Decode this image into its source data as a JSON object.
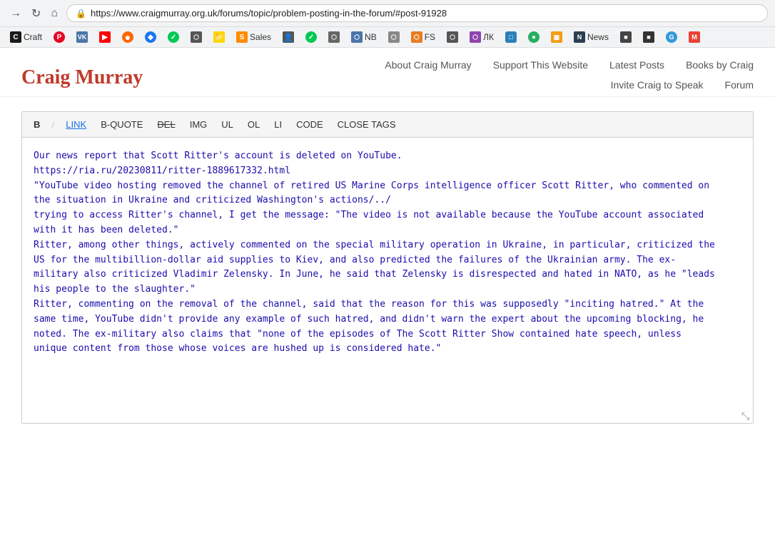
{
  "browser": {
    "url": "https://www.craigmurray.org.uk/forums/topic/problem-posting-in-the-forum/#post-91928",
    "lock_icon": "🔒"
  },
  "bookmarks": [
    {
      "label": "Craft",
      "icon_char": "C",
      "color_class": "bm-craft"
    },
    {
      "label": "",
      "icon_char": "P",
      "color_class": "bm-pinterest"
    },
    {
      "label": "",
      "icon_char": "B",
      "color_class": "bm-vk"
    },
    {
      "label": "",
      "icon_char": "▶",
      "color_class": "bm-youtube"
    },
    {
      "label": "",
      "icon_char": "●",
      "color_class": "bm-orange"
    },
    {
      "label": "",
      "icon_char": "◆",
      "color_class": "bm-blue"
    },
    {
      "label": "",
      "icon_char": "✓",
      "color_class": "bm-green"
    },
    {
      "label": "",
      "icon_char": "⬡",
      "color_class": "bm-dark1"
    },
    {
      "label": "Sales",
      "icon_char": "S",
      "color_class": "bm-sales"
    },
    {
      "label": "",
      "icon_char": "👤",
      "color_class": "bm-dark2"
    },
    {
      "label": "",
      "icon_char": "✓",
      "color_class": "bm-green"
    },
    {
      "label": "",
      "icon_char": "⬡",
      "color_class": "bm-dark1"
    },
    {
      "label": "NB",
      "icon_char": "N",
      "color_class": "bm-nb"
    },
    {
      "label": "",
      "icon_char": "⬡",
      "color_class": "bm-dark1"
    },
    {
      "label": "FS",
      "icon_char": "F",
      "color_class": "bm-fs"
    },
    {
      "label": "",
      "icon_char": "⬡",
      "color_class": "bm-dark1"
    },
    {
      "label": "ЛК",
      "icon_char": "Л",
      "color_class": "bm-lk"
    },
    {
      "label": "",
      "icon_char": "□",
      "color_class": "bm-3d"
    },
    {
      "label": "",
      "icon_char": "●",
      "color_class": "bm-leaf"
    },
    {
      "label": "",
      "icon_char": "▣",
      "color_class": "bm-yellow-folder"
    },
    {
      "label": "News",
      "icon_char": "N",
      "color_class": "bm-news-icon"
    },
    {
      "label": "",
      "icon_char": "■",
      "color_class": "bm-dark1"
    },
    {
      "label": "",
      "icon_char": "■",
      "color_class": "bm-dark2"
    },
    {
      "label": "",
      "icon_char": "G",
      "color_class": "bm-blue2"
    },
    {
      "label": "",
      "icon_char": "M",
      "color_class": "bm-gmail"
    }
  ],
  "site": {
    "logo": "Craig Murray",
    "nav": {
      "row1": [
        {
          "label": "About Craig Murray",
          "href": "#"
        },
        {
          "label": "Support This Website",
          "href": "#"
        },
        {
          "label": "Latest Posts",
          "href": "#"
        },
        {
          "label": "Books by Craig",
          "href": "#"
        }
      ],
      "row2": [
        {
          "label": "Invite Craig to Speak",
          "href": "#"
        },
        {
          "label": "Forum",
          "href": "#"
        }
      ]
    }
  },
  "editor": {
    "toolbar": {
      "bold": "B",
      "italic": "I",
      "link": "LINK",
      "bquote": "B-QUOTE",
      "del": "DEL",
      "img": "IMG",
      "ul": "UL",
      "ol": "OL",
      "li": "LI",
      "code": "CODE",
      "close_tags": "CLOSE TAGS"
    },
    "content": "Our news report that Scott Ritter's account is deleted on YouTube.\nhttps://ria.ru/20230811/ritter-1889617332.html\n\"YouTube video hosting removed the channel of retired US Marine Corps intelligence officer Scott Ritter, who commented on\nthe situation in Ukraine and criticized Washington's actions/../\ntrying to access Ritter's channel, I get the message: \"The video is not available because the YouTube account associated\nwith it has been deleted.\"\nRitter, among other things, actively commented on the special military operation in Ukraine, in particular, criticized the\nUS for the multibillion-dollar aid supplies to Kiev, and also predicted the failures of the Ukrainian army. The ex-\nmilitary also criticized Vladimir Zelensky. In June, he said that Zelensky is disrespected and hated in NATO, as he \"leads\nhis people to the slaughter.\"\nRitter, commenting on the removal of the channel, said that the reason for this was supposedly \"inciting hatred.\" At the\nsame time, YouTube didn't provide any example of such hatred, and didn't warn the expert about the upcoming blocking, he\nnoted. The ex-military also claims that \"none of the episodes of The Scott Ritter Show contained hate speech, unless\nunique content from those whose voices are hushed up is considered hate.\""
  }
}
